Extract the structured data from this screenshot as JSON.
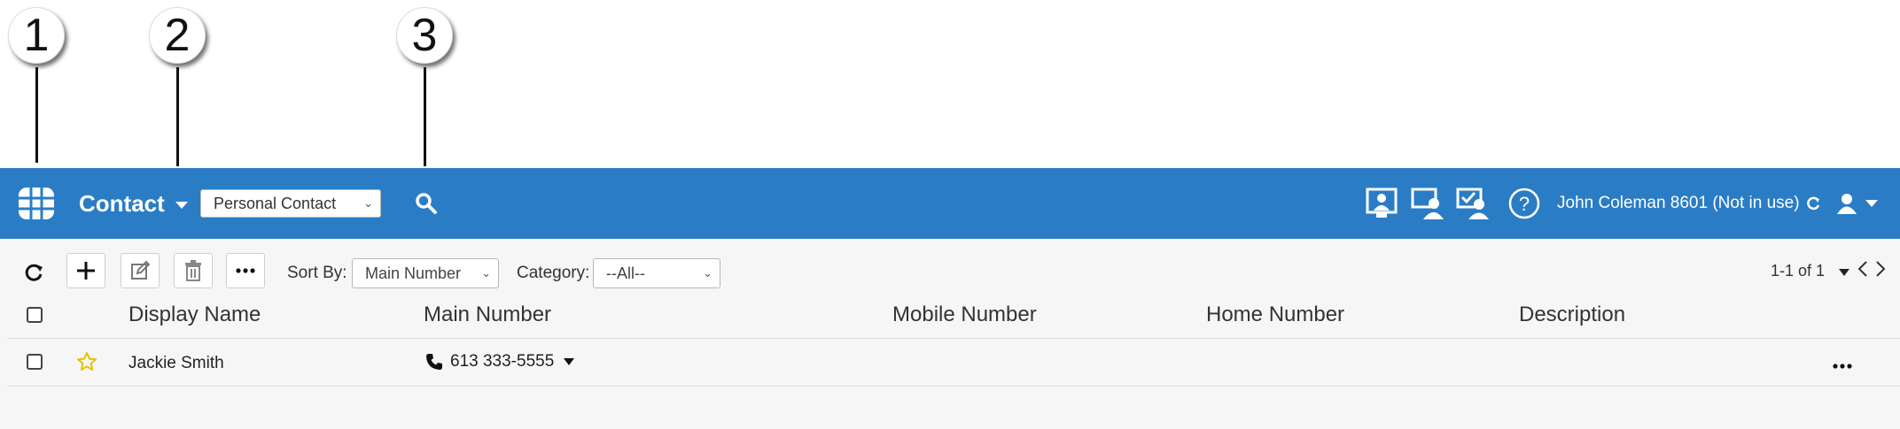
{
  "callouts": [
    "1",
    "2",
    "3"
  ],
  "header": {
    "title": "Contact",
    "contact_type_selected": "Personal Contact",
    "user_status": "John Coleman 8601  (Not in use)"
  },
  "toolbar": {
    "sort_by_label": "Sort By:",
    "sort_by_value": "Main Number",
    "category_label": "Category:",
    "category_value": "--All--",
    "pagination": "1-1 of 1"
  },
  "table": {
    "columns": [
      "Display Name",
      "Main Number",
      "Mobile Number",
      "Home Number",
      "Description"
    ],
    "rows": [
      {
        "display_name": "Jackie Smith",
        "main_number": "613 333-5555",
        "mobile_number": "",
        "home_number": "",
        "description": ""
      }
    ]
  },
  "colors": {
    "header_bg": "#2a7dc5",
    "content_bg": "#f6f6f6",
    "favorite_star": "#e8c200"
  }
}
